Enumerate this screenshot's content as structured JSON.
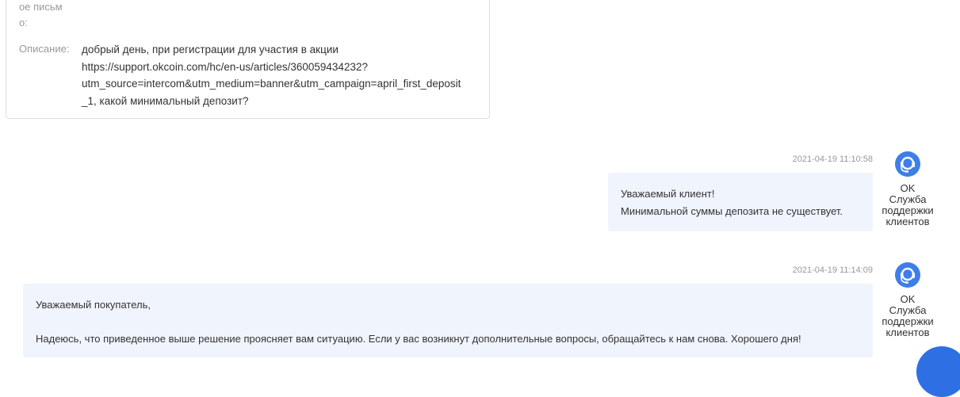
{
  "ticket": {
    "fragment_line1": "ое письм",
    "fragment_line2": "о:",
    "description_label": "Описание:",
    "description_value": "добрый день, при регистрации для участия в акции\nhttps://support.okcoin.com/hc/en-us/articles/360059434232?\nutm_source=intercom&utm_medium=banner&utm_campaign=april_first_deposit\n_1, какой минимальный депозит?"
  },
  "messages": [
    {
      "timestamp": "2021-04-19 11:10:58",
      "text": "Уважаемый клиент!\nМинимальной суммы депозита не существует.",
      "author": "OK\nСлужба\nподдержки\nклиентов",
      "avatar_icon": "headset-agent-icon"
    },
    {
      "timestamp": "2021-04-19 11:14:09",
      "text": "Уважаемый покупатель,\n\nНадеюсь, что приведенное выше решение проясняет вам ситуацию. Если у вас возникнут дополнительные вопросы, обращайтесь к нам снова. Хорошего дня!",
      "author": "OK\nСлужба\nподдержки\nклиентов",
      "avatar_icon": "headset-agent-icon"
    }
  ],
  "chat_widget": {
    "icon": "chat-bubble-icon"
  },
  "colors": {
    "bubble_bg": "#f0f4fd",
    "avatar": "#3f7ee8",
    "chat_button": "#2f6fe4",
    "muted_text": "#999999"
  }
}
